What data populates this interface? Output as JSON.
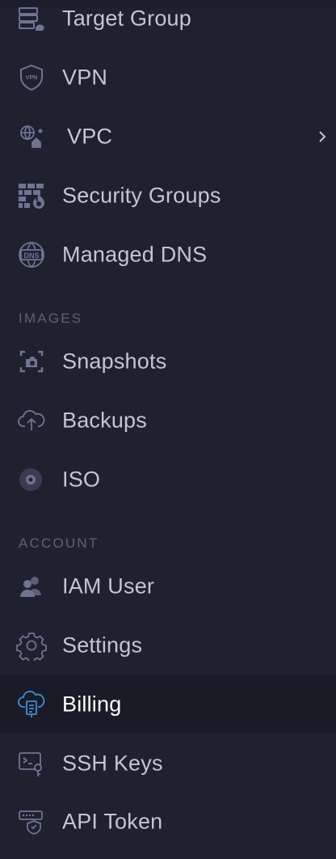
{
  "sidebar": {
    "network_items": [
      {
        "label": "Target Group",
        "icon": "target-group-icon"
      },
      {
        "label": "VPN",
        "icon": "vpn-shield-icon",
        "icon_text": "VPN"
      },
      {
        "label": "VPC",
        "icon": "vpc-network-icon",
        "has_submenu": true
      },
      {
        "label": "Security Groups",
        "icon": "firewall-icon"
      },
      {
        "label": "Managed DNS",
        "icon": "dns-globe-icon",
        "icon_text": "DNS"
      }
    ],
    "images_header": "IMAGES",
    "images_items": [
      {
        "label": "Snapshots",
        "icon": "snapshot-camera-icon"
      },
      {
        "label": "Backups",
        "icon": "cloud-upload-icon"
      },
      {
        "label": "ISO",
        "icon": "disc-icon"
      }
    ],
    "account_header": "ACCOUNT",
    "account_items": [
      {
        "label": "IAM User",
        "icon": "users-icon"
      },
      {
        "label": "Settings",
        "icon": "gear-icon"
      },
      {
        "label": "Billing",
        "icon": "cloud-billing-icon",
        "active": true
      },
      {
        "label": "SSH Keys",
        "icon": "terminal-key-icon"
      },
      {
        "label": "API Token",
        "icon": "api-token-shield-icon"
      }
    ]
  },
  "colors": {
    "background": "#20212f",
    "active_background": "#1a1b27",
    "label": "#c3c5d3",
    "active_label": "#ffffff",
    "section_header": "#5d6078",
    "icon_muted": "#6f7493",
    "icon_active": "#3b8fd9",
    "icon_accent": "#5a6a9c"
  }
}
